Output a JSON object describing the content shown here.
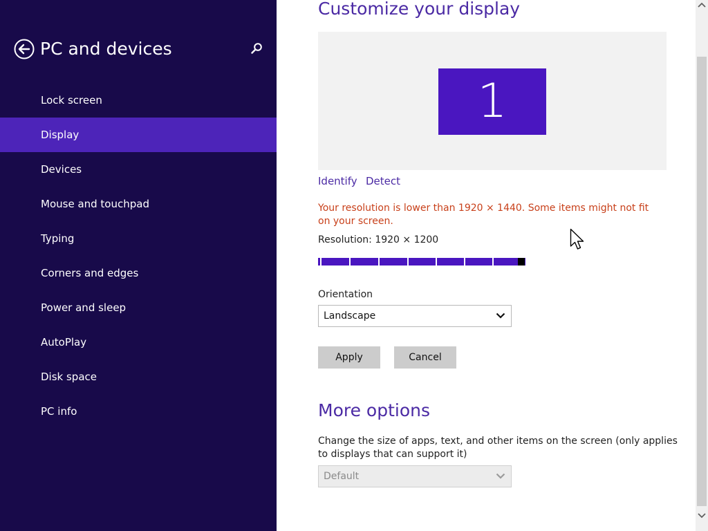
{
  "sidebar": {
    "title": "PC and devices",
    "back_icon": "back-arrow-circle-icon",
    "search_icon": "search-icon",
    "items": [
      {
        "label": "Lock screen"
      },
      {
        "label": "Display",
        "selected": true
      },
      {
        "label": "Devices"
      },
      {
        "label": "Mouse and touchpad"
      },
      {
        "label": "Typing"
      },
      {
        "label": "Corners and edges"
      },
      {
        "label": "Power and sleep"
      },
      {
        "label": "AutoPlay"
      },
      {
        "label": "Disk space"
      },
      {
        "label": "PC info"
      }
    ]
  },
  "main": {
    "heading": "Customize your display",
    "monitor_label": "1",
    "identify_label": "Identify",
    "detect_label": "Detect",
    "warning": "Your resolution is lower than 1920 × 1440. Some items might not fit on your screen.",
    "resolution_label": "Resolution: 1920 × 1200",
    "resolution_slider": {
      "steps": 8,
      "value_fraction": 0.97
    },
    "orientation_label": "Orientation",
    "orientation_value": "Landscape",
    "apply_label": "Apply",
    "cancel_label": "Cancel",
    "more_heading": "More options",
    "scale_desc": "Change the size of apps, text, and other items on the screen (only applies to displays that can support it)",
    "scale_value": "Default"
  },
  "colors": {
    "sidebar_bg": "#180a4a",
    "selected_bg": "#4d24b9",
    "accent": "#4b2aa4",
    "warning": "#c8401a",
    "monitor": "#4a16c0"
  }
}
